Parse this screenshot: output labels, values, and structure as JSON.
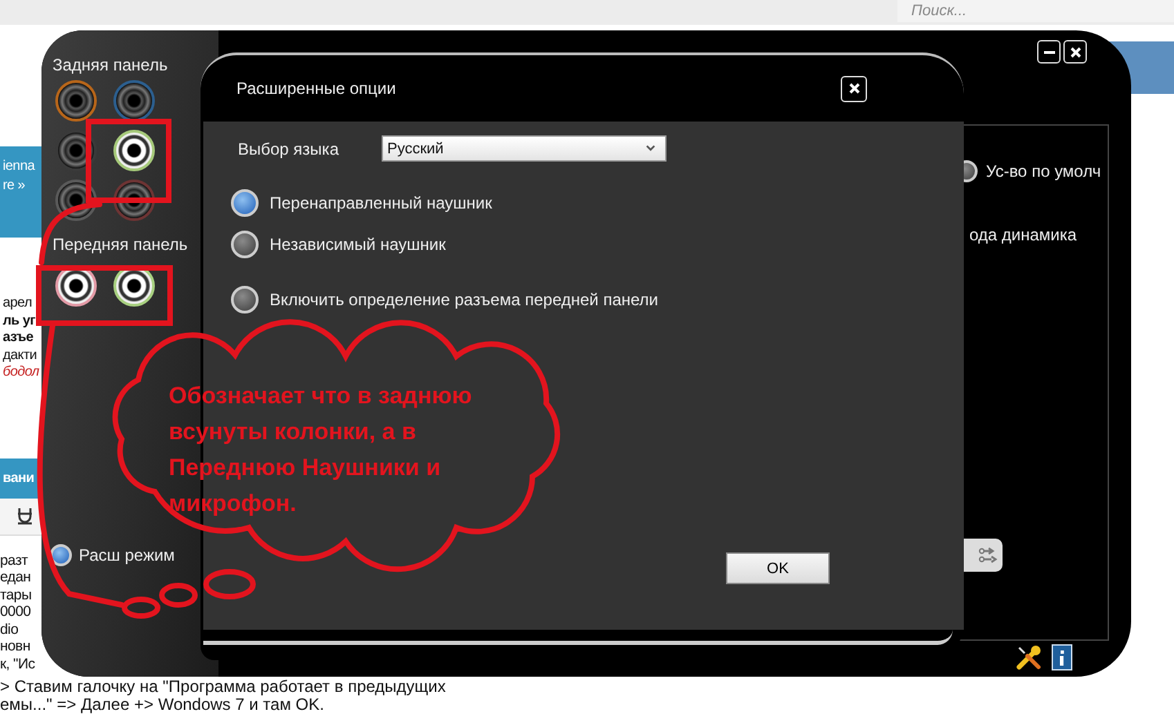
{
  "web_page": {
    "search": {
      "placeholder": "Поиск..."
    },
    "blocks": [
      {
        "kind": "header",
        "lines": [
          "ienna",
          "re »"
        ]
      },
      {
        "kind": "text",
        "lines": [
          {
            "text": "арел",
            "kind": "plain"
          },
          {
            "text": "ль уг",
            "kind": "bold"
          },
          {
            "text": "азъе",
            "kind": "bold"
          },
          {
            "text": "дакти",
            "kind": "plain"
          },
          {
            "text": "бодол",
            "kind": "red"
          }
        ]
      },
      {
        "kind": "bar",
        "lines": [
          "вани"
        ]
      }
    ],
    "body_lines": [
      "разт",
      "едан",
      "тары",
      "0000",
      "dio",
      "новн",
      "к, \"Ис"
    ],
    "bottom_lines": [
      "> Ставим галочку на \"Программа работает в предыдущих",
      "емы...\" => Далее +> Wondows 7 и там OK."
    ]
  },
  "app": {
    "rear_panel_label": "Задняя панель",
    "rear_jacks": [
      {
        "color": "#b8661a",
        "active": false
      },
      {
        "color": "#2c5f8f",
        "active": false
      },
      {
        "color": "#3a3a3a",
        "active": false
      },
      {
        "color": "#a6c97a",
        "active": true
      },
      {
        "color": "#5a5a5a",
        "active": false
      },
      {
        "color": "#6e3434",
        "active": false
      }
    ],
    "front_panel_label": "Передняя панель",
    "front_jacks": [
      {
        "color": "#e39aa6",
        "active": true
      },
      {
        "color": "#a8d080",
        "active": true
      }
    ],
    "mode_radio": {
      "label": "Расш режим",
      "selected": true
    },
    "default_device": {
      "label": "Ус-во по умолч",
      "selected": false
    },
    "speaker_label": "ода динамика"
  },
  "dialog": {
    "title": "Расширенные опции",
    "language_label": "Выбор языка",
    "language_value": "Русский",
    "options": [
      {
        "label": "Перенаправленный наушник",
        "selected": true
      },
      {
        "label": "Независимый наушник",
        "selected": false
      },
      {
        "label": "Включить определение разъема передней панели",
        "selected": false
      }
    ],
    "ok_button": "OK"
  },
  "annotation": {
    "text": "Обозначает что в заднюю всунуты колонки, а в Переднюю Наушники и микрофон."
  }
}
